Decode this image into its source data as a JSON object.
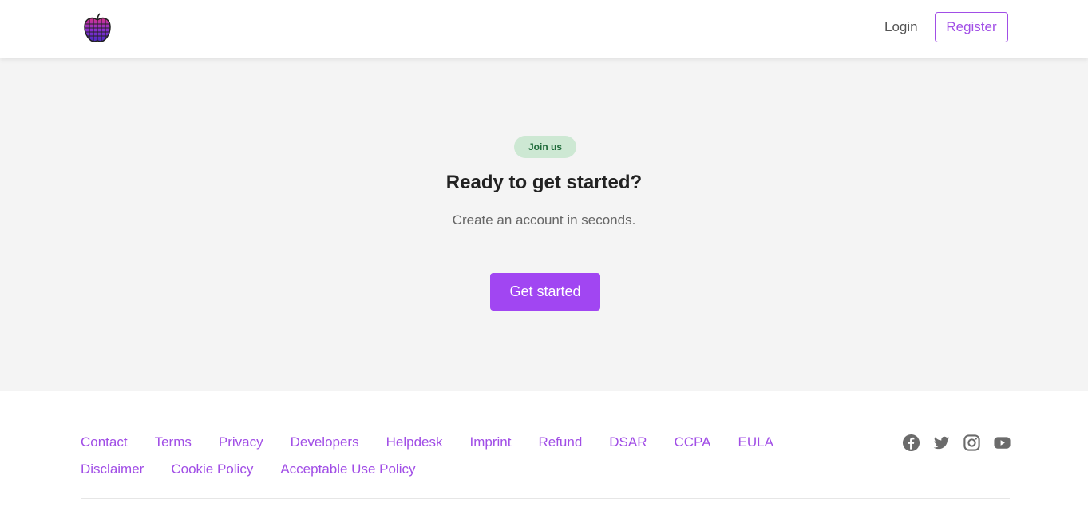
{
  "header": {
    "logo_name": "apple-logo",
    "login_label": "Login",
    "register_label": "Register"
  },
  "hero": {
    "badge": "Join us",
    "title": "Ready to get started?",
    "subtitle": "Create an account in seconds.",
    "cta_label": "Get started"
  },
  "footer": {
    "links": [
      {
        "label": "Contact"
      },
      {
        "label": "Terms"
      },
      {
        "label": "Privacy"
      },
      {
        "label": "Developers"
      },
      {
        "label": "Helpdesk"
      },
      {
        "label": "Imprint"
      },
      {
        "label": "Refund"
      },
      {
        "label": "DSAR"
      },
      {
        "label": "CCPA"
      },
      {
        "label": "EULA"
      },
      {
        "label": "Disclaimer"
      },
      {
        "label": "Cookie Policy"
      },
      {
        "label": "Acceptable Use Policy"
      }
    ],
    "socials": [
      {
        "icon": "facebook-icon"
      },
      {
        "icon": "twitter-icon"
      },
      {
        "icon": "instagram-icon"
      },
      {
        "icon": "youtube-icon"
      }
    ]
  },
  "colors": {
    "accent": "#a146f2",
    "link": "#a14ee6",
    "badge_bg": "#cde8d3",
    "badge_text": "#1f6b3a",
    "hero_bg": "#f4f4f4"
  }
}
